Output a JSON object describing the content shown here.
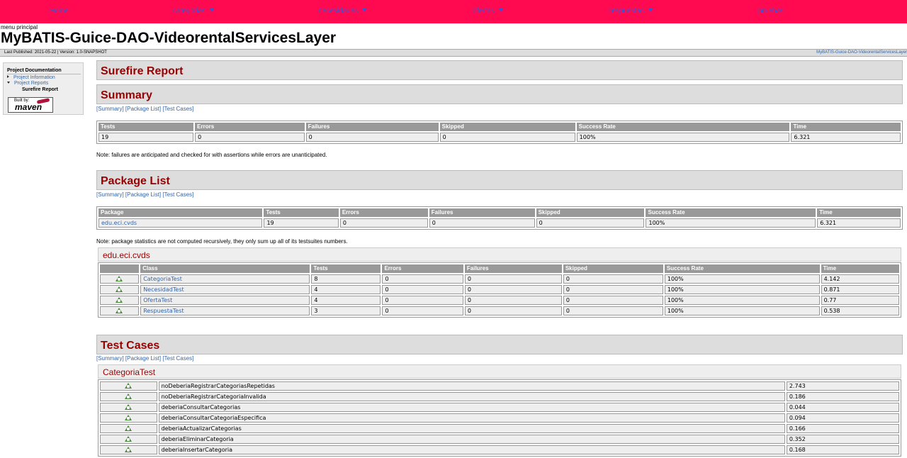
{
  "nav": [
    {
      "label": "Home",
      "dropdown": false
    },
    {
      "label": "categorias",
      "dropdown": true
    },
    {
      "label": "necesidades",
      "dropdown": true
    },
    {
      "label": "ofertas",
      "dropdown": true
    },
    {
      "label": "respuestas",
      "dropdown": true
    },
    {
      "label": "pruebas",
      "dropdown": false
    }
  ],
  "menu_principal": "menu principal",
  "site_title": "MyBATIS-Guice-DAO-VideorentalServicesLayer",
  "breadcrumb_left": "Last Published: 2021-05-22 | Version: 1.0-SNAPSHOT",
  "breadcrumb_right": "MyBATIS-Guice-DAO-VideorentalServicesLayer",
  "sidebar": {
    "title": "Project Documentation",
    "items": [
      {
        "label": "Project Information"
      },
      {
        "label": "Project Reports"
      }
    ],
    "current": "Surefire Report",
    "badge_top": "Built by:",
    "badge_name": "maven"
  },
  "links": {
    "summary": "[Summary]",
    "packages": "[Package List]",
    "tests": "[Test Cases]"
  },
  "surefire_title": "Surefire Report",
  "summary": {
    "title": "Summary",
    "headers": [
      "Tests",
      "Errors",
      "Failures",
      "Skipped",
      "Success Rate",
      "Time"
    ],
    "row": [
      "19",
      "0",
      "0",
      "0",
      "100%",
      "6.321"
    ],
    "note": "Note: failures are anticipated and checked for with assertions while errors are unanticipated."
  },
  "package_list": {
    "title": "Package List",
    "headers": [
      "Package",
      "Tests",
      "Errors",
      "Failures",
      "Skipped",
      "Success Rate",
      "Time"
    ],
    "row": [
      "edu.eci.cvds",
      "19",
      "0",
      "0",
      "0",
      "100%",
      "6.321"
    ],
    "note": "Note: package statistics are not computed recursively, they only sum up all of its testsuites numbers."
  },
  "package_detail": {
    "name": "edu.eci.cvds",
    "headers": [
      "",
      "Class",
      "Tests",
      "Errors",
      "Failures",
      "Skipped",
      "Success Rate",
      "Time"
    ],
    "rows": [
      [
        "CategoriaTest",
        "8",
        "0",
        "0",
        "0",
        "100%",
        "4.142"
      ],
      [
        "NecesidadTest",
        "4",
        "0",
        "0",
        "0",
        "100%",
        "0.871"
      ],
      [
        "OfertaTest",
        "4",
        "0",
        "0",
        "0",
        "100%",
        "0.77"
      ],
      [
        "RespuestaTest",
        "3",
        "0",
        "0",
        "0",
        "100%",
        "0.538"
      ]
    ]
  },
  "test_cases": {
    "title": "Test Cases",
    "class_name": "CategoriaTest",
    "rows": [
      [
        "noDeberiaRegistrarCategoriasRepetidas",
        "2.743"
      ],
      [
        "noDeberiaRegistrarCategoriaInvalida",
        "0.186"
      ],
      [
        "deberiaConsultarCategorias",
        "0.044"
      ],
      [
        "deberiaConsultarCategoriaEspecifica",
        "0.094"
      ],
      [
        "deberiaActualizarCategorias",
        "0.166"
      ],
      [
        "deberiaEliminarCategoria",
        "0.352"
      ],
      [
        "deberiaInsertarCategoria",
        "0.168"
      ]
    ]
  },
  "colors": {
    "nav_bg": "#ff0a50",
    "nav_link": "#3a56d8",
    "heading": "#990000",
    "link": "#3366aa",
    "pass_icon": "#4a8a3a"
  }
}
